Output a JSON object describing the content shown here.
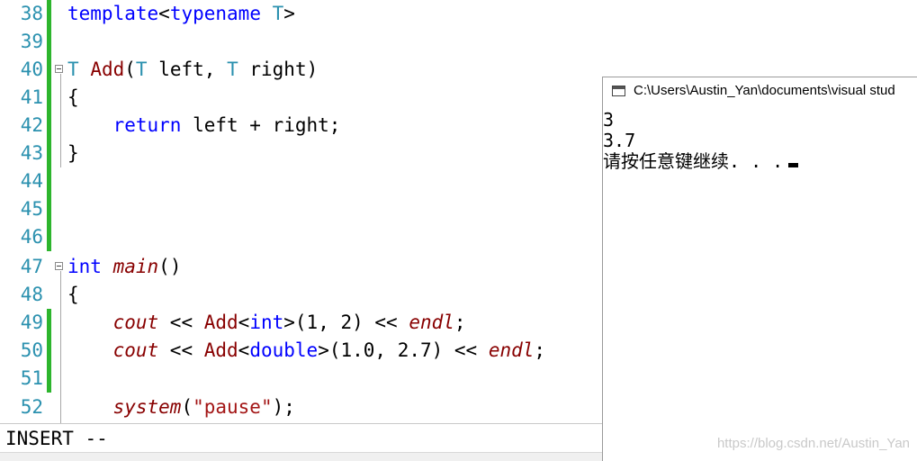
{
  "editor": {
    "line_numbers": [
      "38",
      "39",
      "40",
      "41",
      "42",
      "43",
      "44",
      "45",
      "46",
      "47",
      "48",
      "49",
      "50",
      "51",
      "52"
    ],
    "code": {
      "l38_kw": "template",
      "l38_lt": "<",
      "l38_kw2": "typename",
      "l38_sp": " ",
      "l38_T": "T",
      "l38_gt": ">",
      "l40_T": "T",
      "l40_fn": "Add",
      "l40_p1": "(",
      "l40_T2": "T",
      "l40_p2": " left, ",
      "l40_T3": "T",
      "l40_p3": " right)",
      "l41": "{",
      "l42_kw": "return",
      "l42_rest": " left + right;",
      "l43": "}",
      "l47_kw": "int",
      "l47_fn": "main",
      "l47_rest": "()",
      "l48": "{",
      "l49_cout": "cout",
      "l49_a": " << ",
      "l49_add": "Add",
      "l49_lt": "<",
      "l49_int": "int",
      "l49_b": ">(1, 2) << ",
      "l49_endl": "endl",
      "l49_c": ";",
      "l50_cout": "cout",
      "l50_a": " << ",
      "l50_add": "Add",
      "l50_lt": "<",
      "l50_dbl": "double",
      "l50_b": ">(1.0, 2.7) << ",
      "l50_endl": "endl",
      "l50_c": ";",
      "l52_sys": "system",
      "l52_a": "(",
      "l52_str": "\"pause\"",
      "l52_b": ");"
    }
  },
  "status_bar": {
    "mode": "INSERT --"
  },
  "console": {
    "title": "C:\\Users\\Austin_Yan\\documents\\visual stud",
    "output": [
      "3",
      "3.7",
      "请按任意键继续. . ."
    ]
  },
  "watermark": "https://blog.csdn.net/Austin_Yan",
  "colors": {
    "keyword": "#0000ff",
    "type_param": "#2b91af",
    "function": "#880000",
    "change_marker": "#2db52d"
  }
}
